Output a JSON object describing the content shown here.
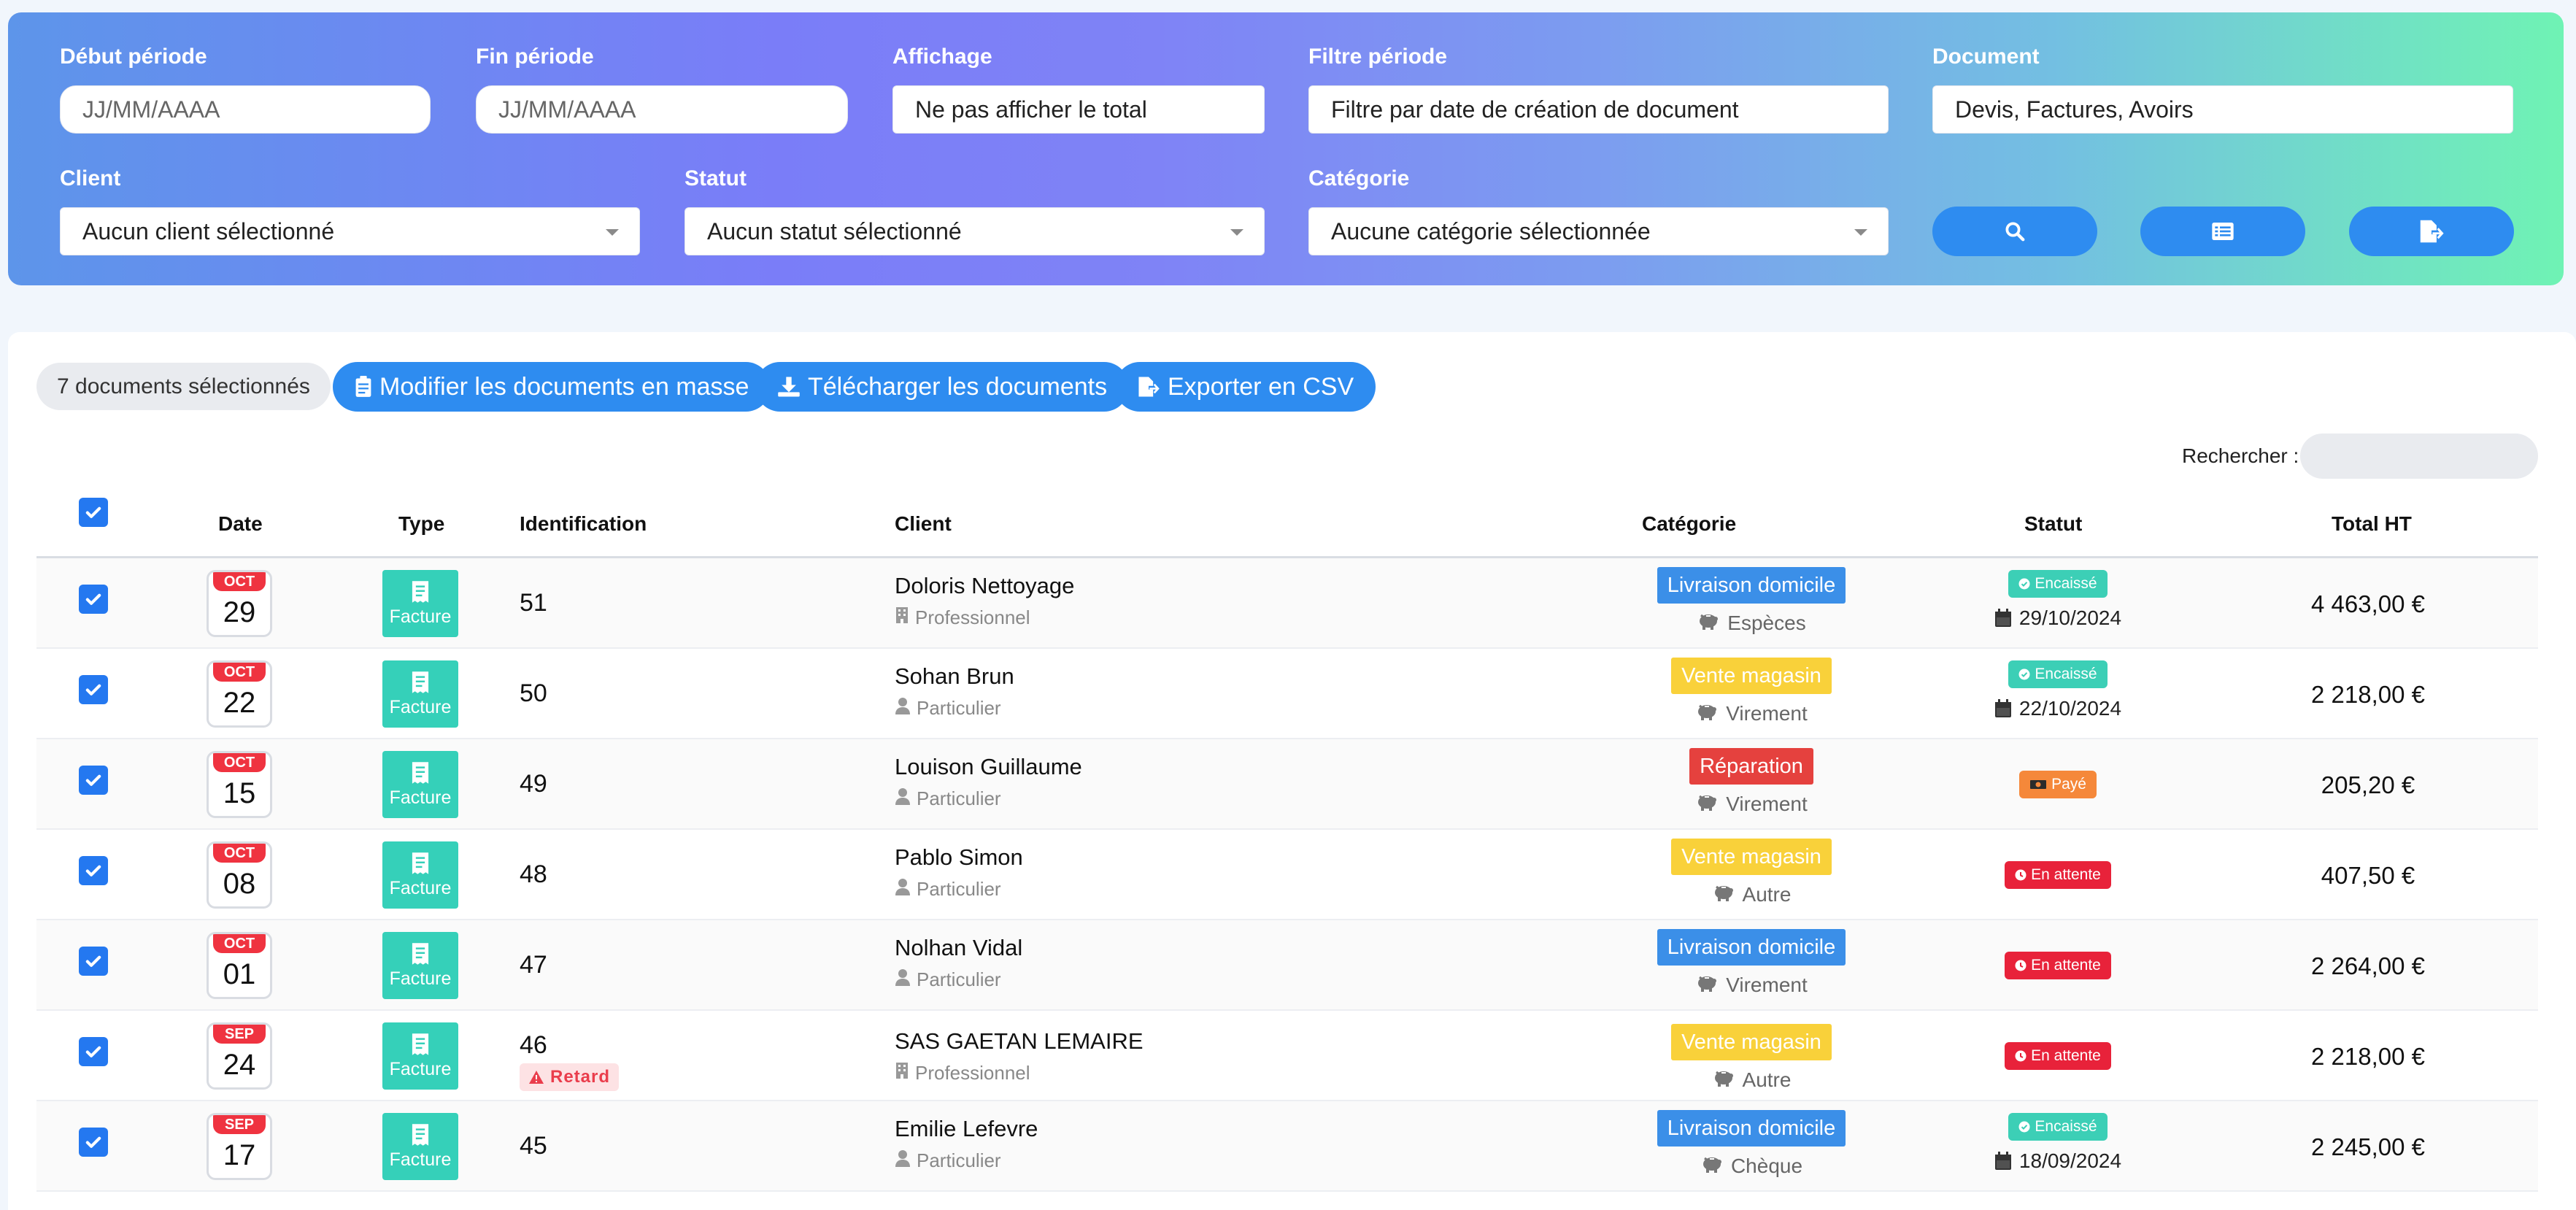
{
  "filters": {
    "start_label": "Début période",
    "start_placeholder": "JJ/MM/AAAA",
    "end_label": "Fin période",
    "end_placeholder": "JJ/MM/AAAA",
    "display_label": "Affichage",
    "display_value": "Ne pas afficher le total",
    "period_filter_label": "Filtre période",
    "period_filter_value": "Filtre par date de création de document",
    "document_label": "Document",
    "document_value": "Devis, Factures, Avoirs",
    "client_label": "Client",
    "client_value": "Aucun client sélectionné",
    "status_label": "Statut",
    "status_value": "Aucun statut sélectionné",
    "category_label": "Catégorie",
    "category_value": "Aucune catégorie sélectionnée"
  },
  "toolbar": {
    "selected_count": "7 documents sélectionnés",
    "bulk_edit": "Modifier les documents en masse",
    "download": "Télécharger les documents",
    "export_csv": "Exporter en CSV",
    "search_label": "Rechercher :"
  },
  "table": {
    "headers": {
      "date": "Date",
      "type": "Type",
      "identification": "Identification",
      "client": "Client",
      "category": "Catégorie",
      "status": "Statut",
      "total": "Total HT"
    },
    "rows": [
      {
        "month": "OCT",
        "day": "29",
        "type": "Facture",
        "id": "51",
        "retard": "",
        "client": "Doloris Nettoyage",
        "client_type": "Professionnel",
        "client_icon": "building-icon",
        "category": "Livraison domicile",
        "cat_color": "#3b8fe8",
        "payment": "Espèces",
        "status": "Encaissé",
        "status_color": "#3ccfb6",
        "status_icon": "check-circle-icon",
        "status_date": "29/10/2024",
        "total": "4 463,00 €"
      },
      {
        "month": "OCT",
        "day": "22",
        "type": "Facture",
        "id": "50",
        "retard": "",
        "client": "Sohan Brun",
        "client_type": "Particulier",
        "client_icon": "user-icon",
        "category": "Vente magasin",
        "cat_color": "#f9d13a",
        "payment": "Virement",
        "status": "Encaissé",
        "status_color": "#3ccfb6",
        "status_icon": "check-circle-icon",
        "status_date": "22/10/2024",
        "total": "2 218,00 €"
      },
      {
        "month": "OCT",
        "day": "15",
        "type": "Facture",
        "id": "49",
        "retard": "",
        "client": "Louison Guillaume",
        "client_type": "Particulier",
        "client_icon": "user-icon",
        "category": "Réparation",
        "cat_color": "#e5413e",
        "payment": "Virement",
        "status": "Payé",
        "status_color": "#f5883a",
        "status_icon": "money-icon",
        "status_date": "",
        "total": "205,20 €"
      },
      {
        "month": "OCT",
        "day": "08",
        "type": "Facture",
        "id": "48",
        "retard": "",
        "client": "Pablo Simon",
        "client_type": "Particulier",
        "client_icon": "user-icon",
        "category": "Vente magasin",
        "cat_color": "#f9d13a",
        "payment": "Autre",
        "status": "En attente",
        "status_color": "#e8223a",
        "status_icon": "clock-icon",
        "status_date": "",
        "total": "407,50 €"
      },
      {
        "month": "OCT",
        "day": "01",
        "type": "Facture",
        "id": "47",
        "retard": "",
        "client": "Nolhan Vidal",
        "client_type": "Particulier",
        "client_icon": "user-icon",
        "category": "Livraison domicile",
        "cat_color": "#3b8fe8",
        "payment": "Virement",
        "status": "En attente",
        "status_color": "#e8223a",
        "status_icon": "clock-icon",
        "status_date": "",
        "total": "2 264,00 €"
      },
      {
        "month": "SEP",
        "day": "24",
        "type": "Facture",
        "id": "46",
        "retard": "Retard",
        "client": "SAS GAETAN LEMAIRE",
        "client_type": "Professionnel",
        "client_icon": "building-icon",
        "category": "Vente magasin",
        "cat_color": "#f9d13a",
        "payment": "Autre",
        "status": "En attente",
        "status_color": "#e8223a",
        "status_icon": "clock-icon",
        "status_date": "",
        "total": "2 218,00 €"
      },
      {
        "month": "SEP",
        "day": "17",
        "type": "Facture",
        "id": "45",
        "retard": "",
        "client": "Emilie Lefevre",
        "client_type": "Particulier",
        "client_icon": "user-icon",
        "category": "Livraison domicile",
        "cat_color": "#3b8fe8",
        "payment": "Chèque",
        "status": "Encaissé",
        "status_color": "#3ccfb6",
        "status_icon": "check-circle-icon",
        "status_date": "18/09/2024",
        "total": "2 245,00 €"
      }
    ]
  }
}
